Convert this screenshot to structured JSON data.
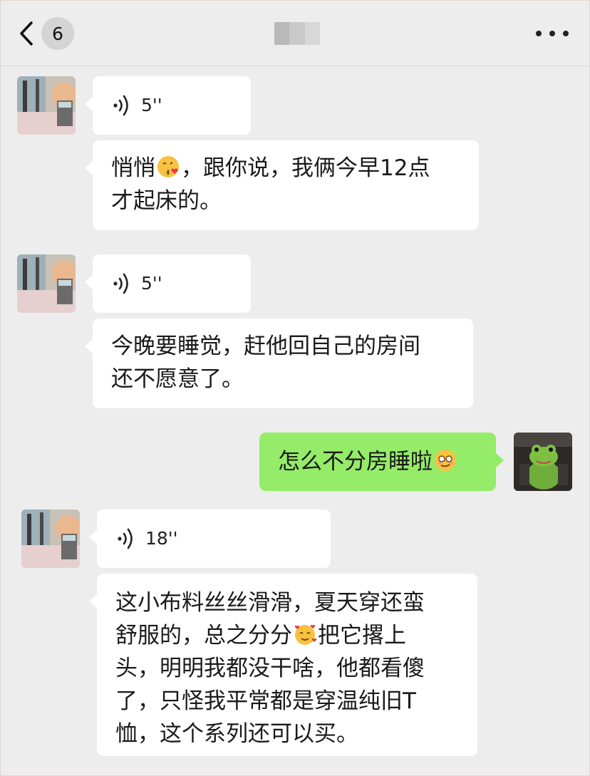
{
  "header": {
    "unread_count": "6",
    "back_icon": "chevron-left-icon",
    "more_icon": "ellipsis-icon"
  },
  "messages": [
    {
      "sender": "contact",
      "type": "voice",
      "duration": "5''"
    },
    {
      "sender": "contact",
      "type": "text",
      "lines": [
        "悄悄",
        "，跟你说，我俩今早12点",
        "才起床的。"
      ]
    },
    {
      "sender": "contact",
      "type": "voice",
      "duration": "5''"
    },
    {
      "sender": "contact",
      "type": "text",
      "lines": [
        "今晚要睡觉，赶他回自己的房间",
        "还不愿意了。"
      ]
    },
    {
      "sender": "me",
      "type": "text",
      "lines": [
        "怎么不分房睡啦"
      ]
    },
    {
      "sender": "contact",
      "type": "voice",
      "duration": "18''"
    },
    {
      "sender": "contact",
      "type": "text",
      "lines": [
        "这小布料丝丝滑滑，夏天穿还蛮",
        "舒服的，总之分分",
        "把它撂上",
        "头，明明我都没干啥，他都看傻",
        "了，只怪我平常都是穿温纯旧T",
        "恤，这个系列还可以买。"
      ]
    }
  ],
  "colors": {
    "background": "#ededed",
    "incoming_bubble": "#ffffff",
    "outgoing_bubble": "#95ec69"
  }
}
